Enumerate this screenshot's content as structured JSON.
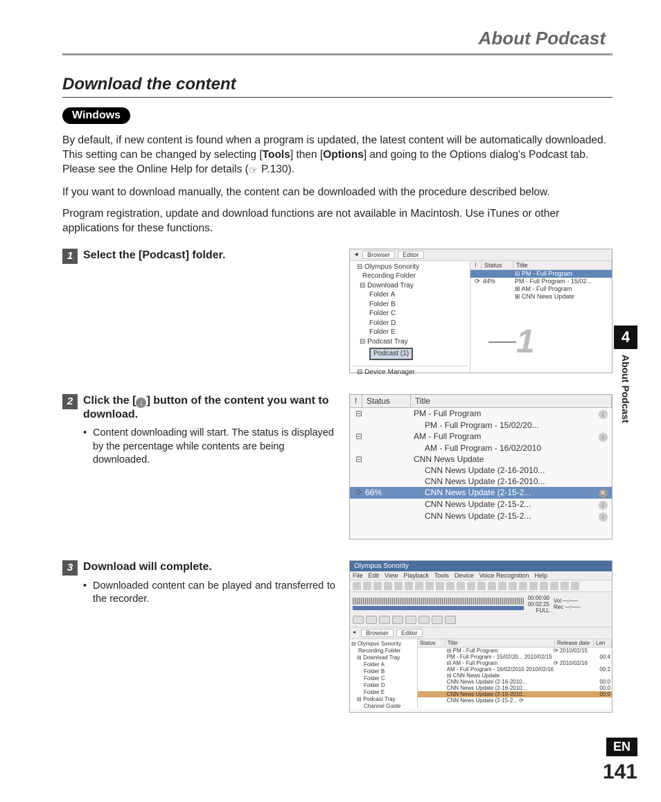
{
  "header": {
    "title": "About Podcast"
  },
  "section": {
    "title": "Download the content"
  },
  "os_label": "Windows",
  "intro": {
    "p1_a": "By default, if new content is found when a program is updated, the latest content will be automatically downloaded. This setting can be changed by selecting [",
    "p1_tools": "Tools",
    "p1_b": "] then [",
    "p1_options": "Options",
    "p1_c": "] and going to the Options dialog's Podcast tab.  Please see the Online Help for details (",
    "p1_ref": " P.130).",
    "p2": "If you want to download manually, the content can be downloaded with the procedure described below.",
    "p3": "Program registration, update and download functions are not available in Macintosh. Use iTunes or other applications for these functions."
  },
  "steps": [
    {
      "num": "1",
      "title_a": "Select the [",
      "title_b": "Podcast",
      "title_c": "] folder.",
      "bullets": []
    },
    {
      "num": "2",
      "title_a": "Click the [",
      "title_c": "] button of the content you want to download.",
      "bullets": [
        "Content downloading will start. The status is displayed by the percentage while contents are being downloaded."
      ]
    },
    {
      "num": "3",
      "title_a": "Download will complete.",
      "bullets": [
        "Downloaded content can be played and transferred to the recorder."
      ]
    }
  ],
  "shot1": {
    "tabs": [
      "Browser",
      "Editor"
    ],
    "tree": {
      "root": "Olympus Sonority",
      "recording": "Recording Folder",
      "download_tray": "Download Tray",
      "folders": [
        "Folder A",
        "Folder B",
        "Folder C",
        "Folder D",
        "Folder E"
      ],
      "podcast_tray": "Podcast Tray",
      "podcast_sel": "Podcast (1)",
      "device": "Device Manager"
    },
    "list": {
      "headers": {
        "exc": "!",
        "status": "Status",
        "title": "Title"
      },
      "rows": [
        {
          "exc": "",
          "status": "",
          "title": "⊟ PM - Full Program",
          "sel": true
        },
        {
          "exc": "⟳",
          "status": "44%",
          "title": "PM - Full Program - 15/02..."
        },
        {
          "exc": "",
          "status": "",
          "title": "⊞ AM - Full Program"
        },
        {
          "exc": "",
          "status": "",
          "title": "⊞ CNN News Update"
        }
      ]
    },
    "callout": "1"
  },
  "shot2": {
    "headers": {
      "exc": "!",
      "status": "Status",
      "title": "Title"
    },
    "rows": [
      {
        "exp": "⊟",
        "status": "",
        "title": "PM - Full Program",
        "dl": true
      },
      {
        "exp": "",
        "status": "",
        "title": "PM - Full Program - 15/02/20...",
        "dl": false
      },
      {
        "exp": "⊟",
        "status": "",
        "title": "AM - Full Program",
        "dl": true
      },
      {
        "exp": "",
        "status": "",
        "title": "AM - Full Program - 16/02/2010",
        "dl": false
      },
      {
        "exp": "⊟",
        "status": "",
        "title": "CNN News Update",
        "dl": false
      },
      {
        "exp": "",
        "status": "",
        "title": "CNN News Update (2-16-2010...",
        "dl": false
      },
      {
        "exp": "",
        "status": "",
        "title": "CNN News Update (2-16-2010...",
        "dl": false
      },
      {
        "exp": "⟳",
        "status": "66%",
        "title": "CNN News Update (2-15-2...",
        "hl": true,
        "x": true
      },
      {
        "exp": "",
        "status": "",
        "title": "CNN News Update (2-15-2...",
        "dl": true
      },
      {
        "exp": "",
        "status": "",
        "title": "CNN News Update (2-15-2...",
        "dl": true
      }
    ]
  },
  "shot3": {
    "app_title": "Olympus Sonority",
    "menus": [
      "File",
      "Edit",
      "View",
      "Playback",
      "Tools",
      "Device",
      "Voice Recognition",
      "Help"
    ],
    "time1": "00:00:00",
    "time2": "00:02:25",
    "full": "FULL",
    "tabs": [
      "Browser",
      "Editor"
    ],
    "tree": {
      "root": "Olympus Sonority",
      "recording": "Recording Folder",
      "download_tray": "Download Tray",
      "folders": [
        "Folder A",
        "Folder B",
        "Folder C",
        "Folder D",
        "Folder E"
      ],
      "podcast_tray": "Podcast Tray",
      "channel": "Channel Guide"
    },
    "list": {
      "headers": {
        "status": "Status",
        "title": "Title",
        "release": "Release date",
        "len": "Len"
      },
      "rows": [
        {
          "title": "⊟ PM - Full Program",
          "release": "⟳ 2010/02/15",
          "len": ""
        },
        {
          "title": "  PM - Full Program - 15/02/20... 2010/02/15",
          "release": "",
          "len": "00:4"
        },
        {
          "title": "⊟ AM - Full Program",
          "release": "⟳ 2010/02/16",
          "len": ""
        },
        {
          "title": "  AM - Full Program - 16/02/2010 2010/02/16",
          "release": "",
          "len": "00:2"
        },
        {
          "title": "⊟ CNN News Update",
          "release": "",
          "len": ""
        },
        {
          "title": "  CNN News Update (2-16-2010...",
          "release": "",
          "len": "00:0"
        },
        {
          "title": "  CNN News Update (2-16-2010...",
          "release": "",
          "len": "00:0"
        },
        {
          "title": "  CNN News Update (2-15-2010...",
          "release": "",
          "len": "00:0",
          "hl": true
        },
        {
          "title": "  CNN News Update (2-15-2... ⟳",
          "release": "",
          "len": ""
        }
      ]
    }
  },
  "side": {
    "num": "4",
    "label": "About Podcast"
  },
  "footer": {
    "lang": "EN",
    "page": "141"
  }
}
